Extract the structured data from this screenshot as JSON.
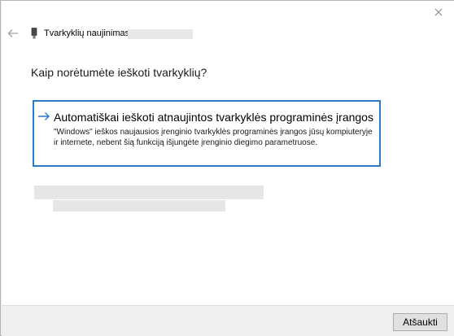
{
  "header": {
    "title": "Tvarkyklių naujinimas",
    "back_icon": "arrow-left-icon",
    "device_icon": "device-icon",
    "close_icon": "close-icon"
  },
  "main": {
    "question": "Kaip norėtumėte ieškoti tvarkyklių?",
    "option": {
      "title": "Automatiškai ieškoti atnaujintos tvarkyklės programinės įrangos",
      "description": "\"Windows\" ieškos naujausios įrenginio tvarkyklės programinės įrangos jūsų kompiuteryje ir internete, nebent šią funkciją išjungėte įrenginio diegimo parametruose.",
      "icon": "arrow-right-icon",
      "accent_color": "#2b79c9"
    }
  },
  "footer": {
    "cancel_label": "Atšaukti"
  }
}
